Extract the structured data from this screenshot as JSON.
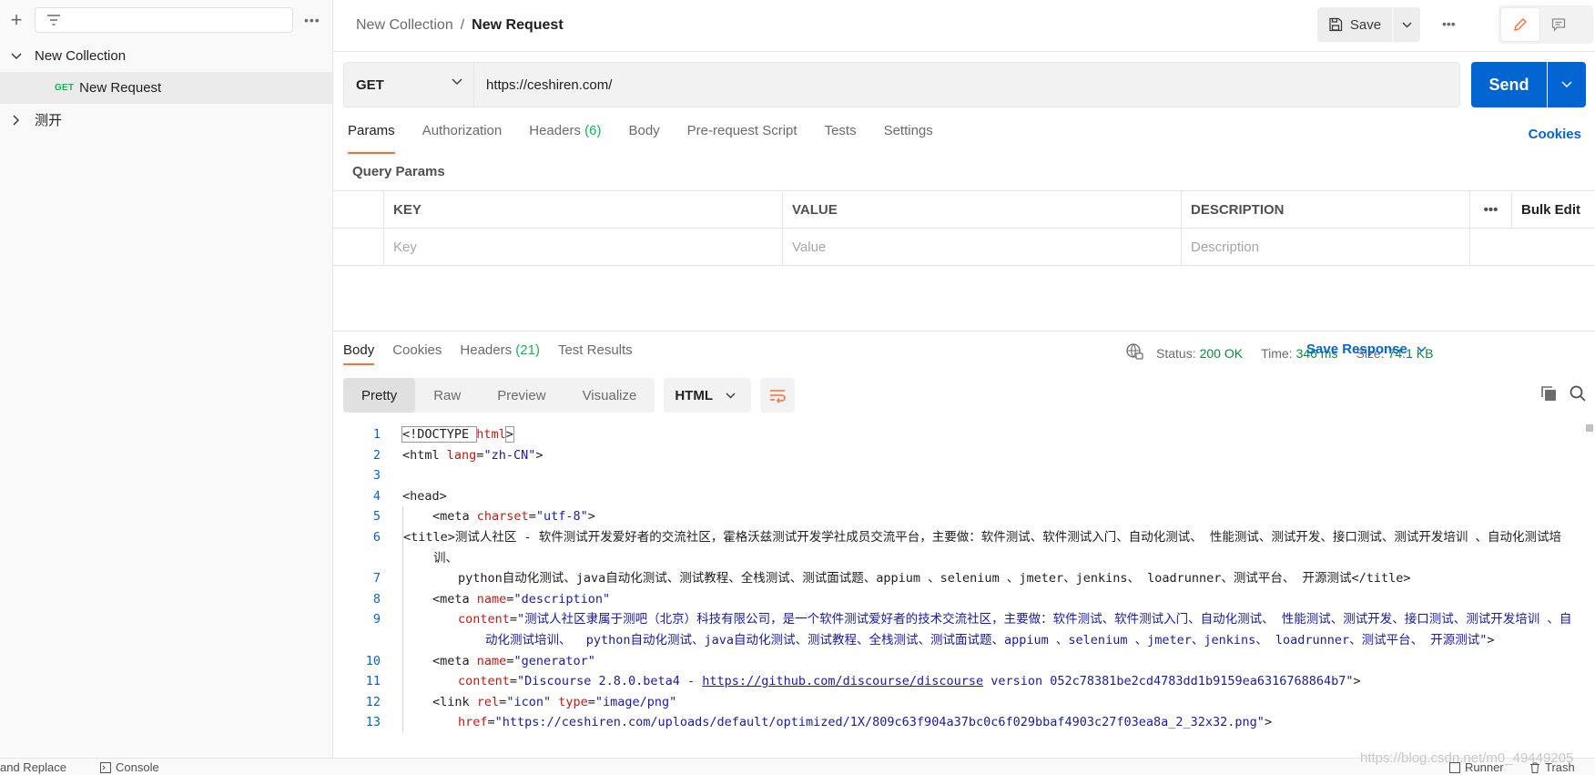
{
  "sidebar": {
    "collection": "New Collection",
    "request": {
      "method": "GET",
      "name": "New Request"
    },
    "folder": "测开"
  },
  "header": {
    "breadcrumb_collection": "New Collection",
    "breadcrumb_sep": "/",
    "breadcrumb_request": "New Request",
    "save_label": "Save"
  },
  "request": {
    "method": "GET",
    "url": "https://ceshiren.com/",
    "send_label": "Send",
    "tabs": [
      {
        "label": "Params"
      },
      {
        "label": "Authorization"
      },
      {
        "label": "Headers",
        "count": "(6)"
      },
      {
        "label": "Body"
      },
      {
        "label": "Pre-request Script"
      },
      {
        "label": "Tests"
      },
      {
        "label": "Settings"
      }
    ],
    "cookies_label": "Cookies",
    "query_params_title": "Query Params",
    "table": {
      "headers": [
        "KEY",
        "VALUE",
        "DESCRIPTION"
      ],
      "bulk_edit": "Bulk Edit",
      "placeholders": [
        "Key",
        "Value",
        "Description"
      ]
    }
  },
  "response": {
    "tabs": [
      {
        "label": "Body"
      },
      {
        "label": "Cookies"
      },
      {
        "label": "Headers",
        "count": "(21)"
      },
      {
        "label": "Test Results"
      }
    ],
    "status_label": "Status:",
    "status_value": "200 OK",
    "time_label": "Time:",
    "time_value": "346 ms",
    "size_label": "Size:",
    "size_value": "74.1 KB",
    "save_response": "Save Response",
    "views": [
      "Pretty",
      "Raw",
      "Preview",
      "Visualize"
    ],
    "language": "HTML"
  },
  "code_lines": {
    "l1": {
      "n": "1",
      "a": "<!DOCTYPE ",
      "b": "html",
      "c": ">"
    },
    "l2": {
      "n": "2",
      "tag": "<html ",
      "attr": "lang",
      "eq": "=",
      "val": "\"zh-CN\"",
      "end": ">"
    },
    "l3": {
      "n": "3"
    },
    "l4": {
      "n": "4",
      "text": "<head>"
    },
    "l5": {
      "n": "5",
      "tag": "<meta ",
      "attr": "charset",
      "eq": "=",
      "val": "\"utf-8\"",
      "end": ">"
    },
    "l6": {
      "n": "6",
      "tag": "<title>",
      "text": "测试人社区 - 软件测试开发爱好者的交流社区，霍格沃兹测试开发学社成员交流平台，主要做：软件测试、软件测试入门、自动化测试、 性能测试、测试开发、接口测试、测试开发培训 、自动化测试培训、"
    },
    "l7": {
      "n": "7",
      "text": "python自动化测试、java自动化测试、测试教程、全栈测试、测试面试题、appium 、selenium 、jmeter、jenkins、 loadrunner、测试平台、 开源测试",
      "end": "</title>"
    },
    "l8": {
      "n": "8",
      "tag": "<meta ",
      "attr": "name",
      "eq": "=",
      "val": "\"description\""
    },
    "l9": {
      "n": "9",
      "attr": "content",
      "eq": "=",
      "val": "\"测试人社区隶属于测吧（北京）科技有限公司，是一个软件测试爱好者的技术交流社区，主要做：软件测试、软件测试入门、自动化测试、 性能测试、测试开发、接口测试、测试开发培训 、自动化测试培训、  python自动化测试、java自动化测试、测试教程、全栈测试、测试面试题、appium 、selenium 、jmeter、jenkins、 loadrunner、测试平台、 开源测试\"",
      "end": ">"
    },
    "l10": {
      "n": "10",
      "tag": "<meta ",
      "attr": "name",
      "eq": "=",
      "val": "\"generator\""
    },
    "l11": {
      "n": "11",
      "attr": "content",
      "eq": "=",
      "val1": "\"Discourse 2.8.0.beta4 - ",
      "link": "https://github.com/discourse/discourse",
      "val2": " version 052c78381be2cd4783dd1b9159ea6316768864b7\"",
      "end": ">"
    },
    "l12": {
      "n": "12",
      "tag": "<link ",
      "attr1": "rel",
      "val1": "\"icon\"",
      "attr2": "type",
      "val2": "\"image/png\"",
      "eq": "="
    },
    "l13": {
      "n": "13",
      "attr": "href",
      "eq": "=",
      "val": "\"https://ceshiren.com/uploads/default/optimized/1X/809c63f904a37bc0c6f029bbaf4903c27f03ea8a_2_32x32.png\"",
      "end": ">"
    }
  },
  "footer": {
    "find_replace": "and Replace",
    "console": "Console",
    "runner": "Runner",
    "trash": "Trash"
  },
  "watermark": "https://blog.csdn.net/m0_49449205",
  "colors": {
    "accent": "#ff6c37",
    "send_blue": "#0265d2",
    "success_green": "#0cbb52"
  }
}
